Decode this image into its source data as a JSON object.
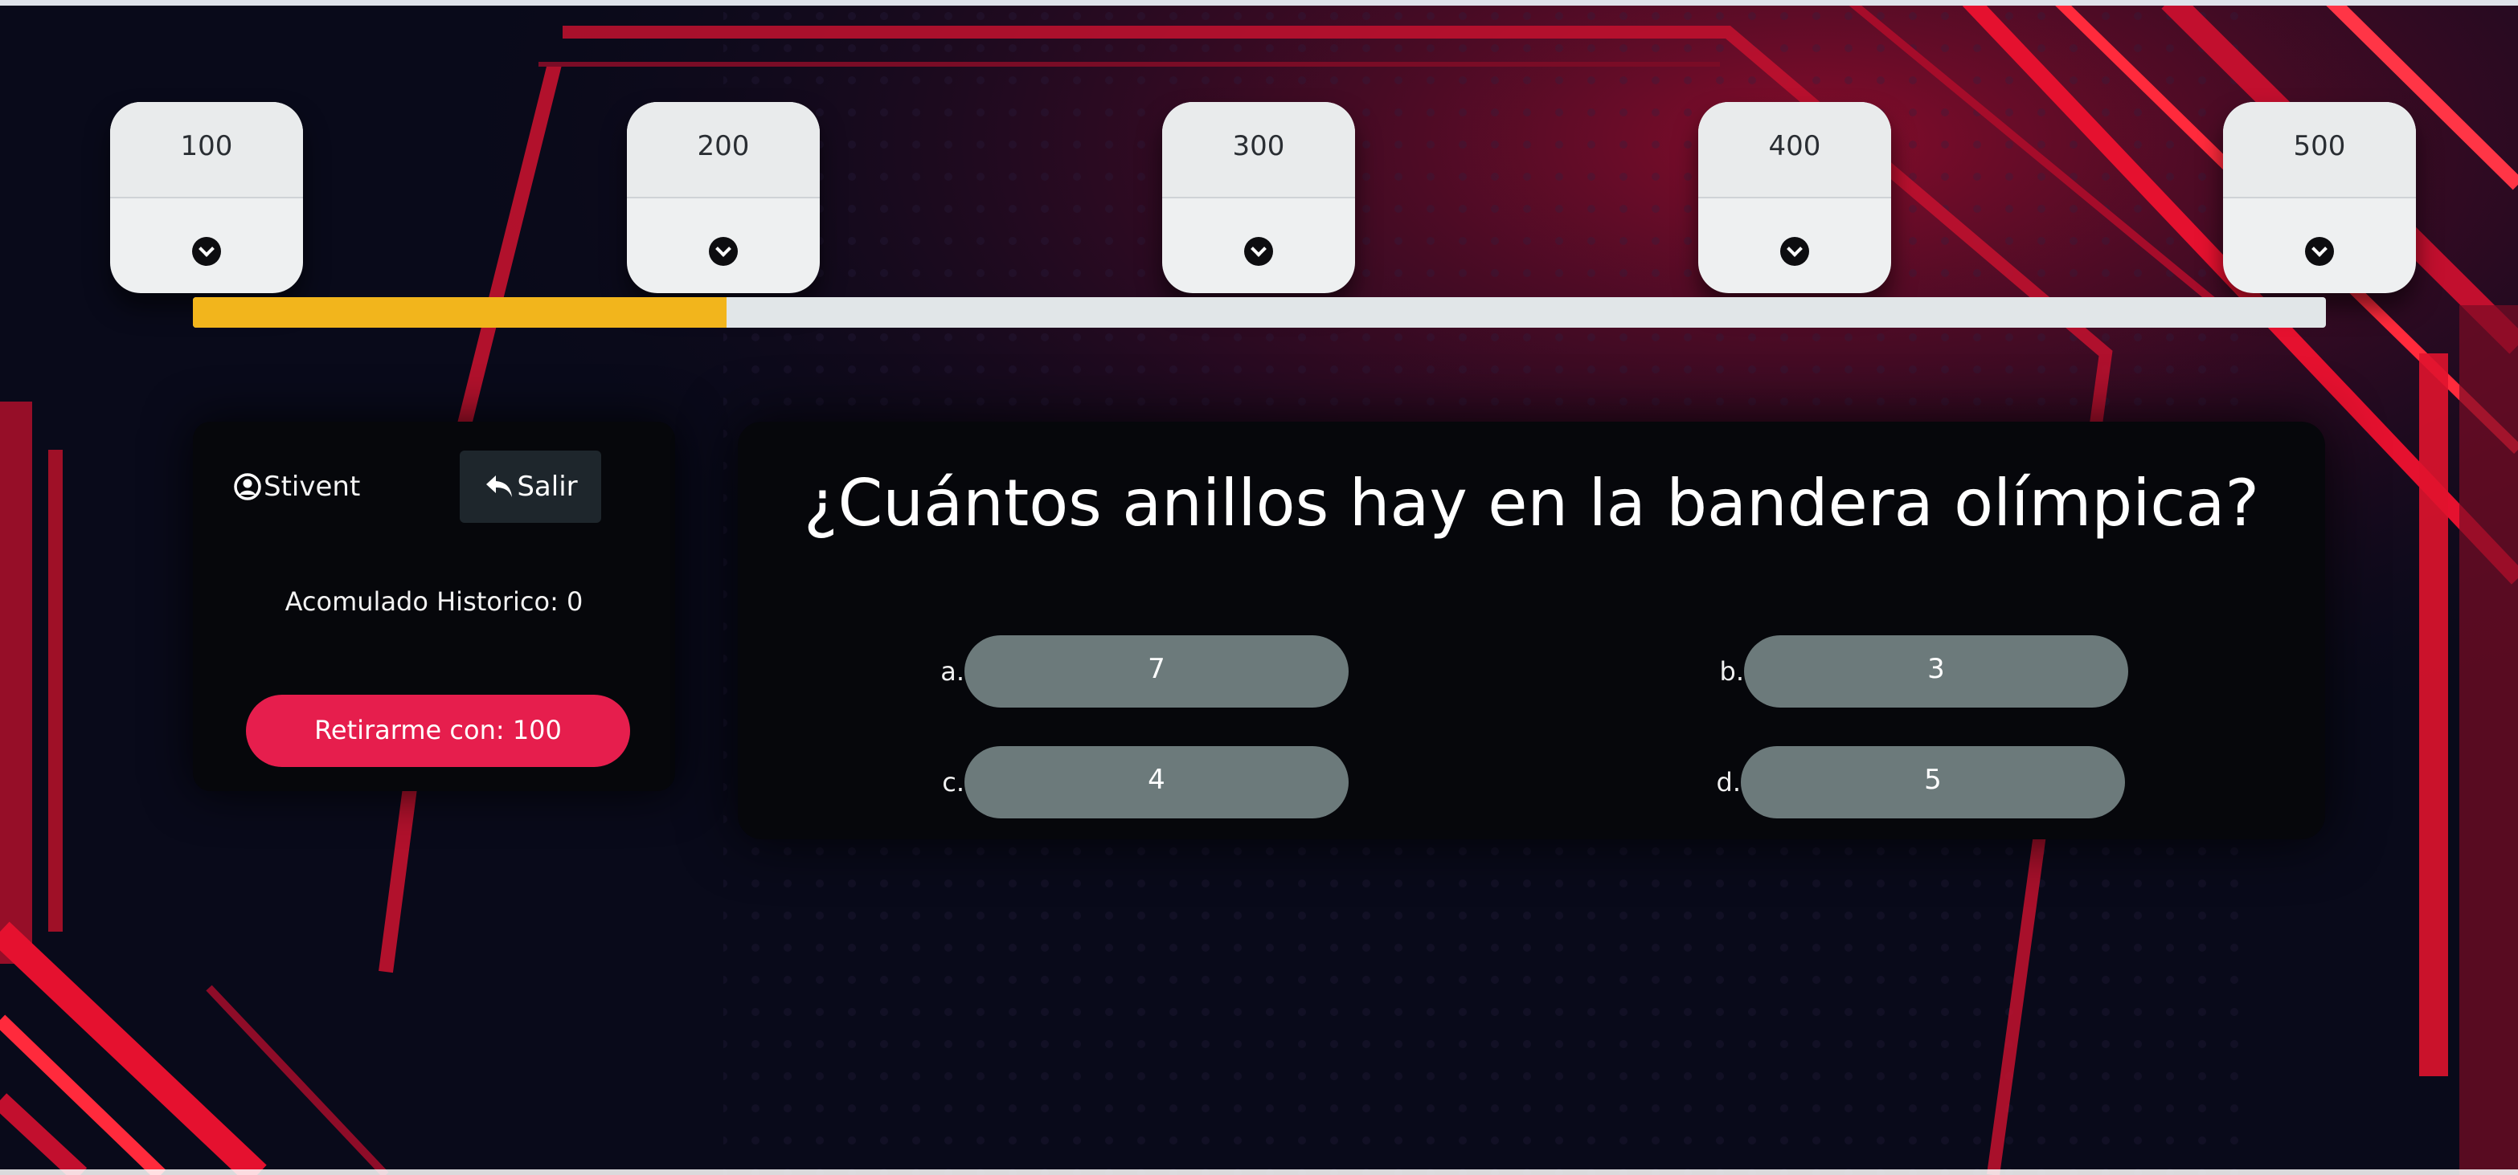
{
  "prizes": [
    {
      "amount": "100"
    },
    {
      "amount": "200"
    },
    {
      "amount": "300"
    },
    {
      "amount": "400"
    },
    {
      "amount": "500"
    }
  ],
  "progress": {
    "fraction": 0.25,
    "fill_color": "#f2b51c",
    "track_color": "#e1e6e8"
  },
  "player": {
    "name": "Stivent",
    "exit_label": "Salir",
    "accumulated": "Acomulado Historico: 0",
    "withdraw_label": "Retirarme con: 100"
  },
  "question": {
    "text": "¿Cuántos anillos hay en la bandera olímpica?",
    "options": [
      {
        "letter": "a.",
        "answer": "7"
      },
      {
        "letter": "b.",
        "answer": "3"
      },
      {
        "letter": "c.",
        "answer": "4"
      },
      {
        "letter": "d.",
        "answer": "5"
      }
    ]
  },
  "colors": {
    "background": "#090a1a",
    "accent_red": "#e61e4d",
    "answer_button": "#6c7a7b",
    "panel": "#06070b"
  },
  "icons": {
    "prize_expand": "chevron-down-circle-icon",
    "user": "user-circle-icon",
    "exit": "reply-arrow-icon"
  }
}
